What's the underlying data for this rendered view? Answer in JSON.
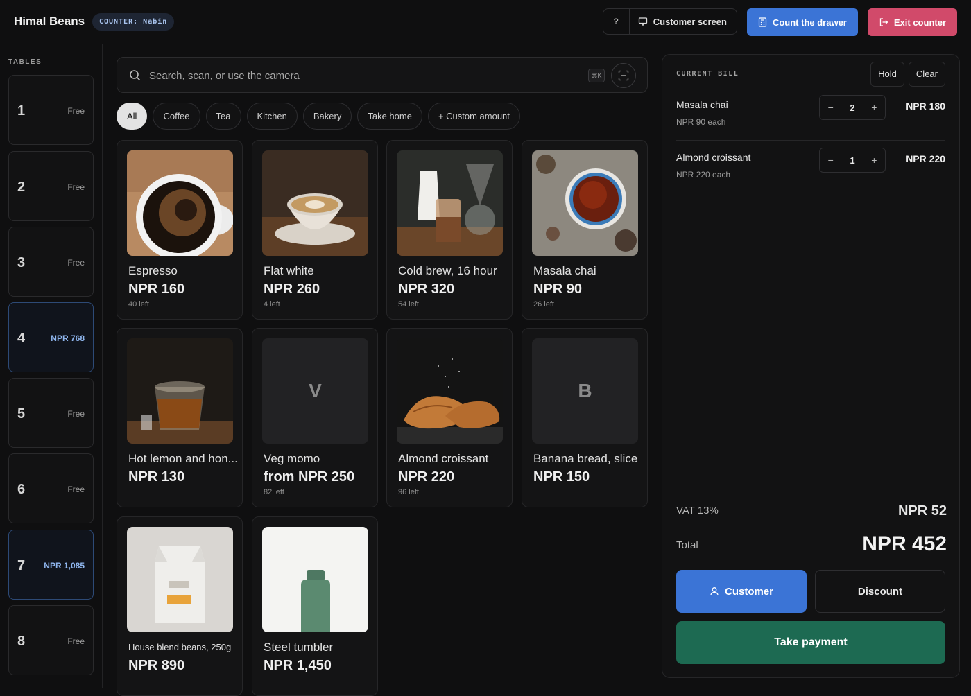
{
  "header": {
    "brand": "Himal Beans",
    "counter_label": "COUNTER: Nabin",
    "help_label": "?",
    "customer_screen_label": "Customer screen",
    "count_drawer_label": "Count the drawer",
    "exit_counter_label": "Exit counter"
  },
  "tables": {
    "title": "TABLES",
    "items": [
      {
        "number": "1",
        "status": "Free"
      },
      {
        "number": "2",
        "status": "Free"
      },
      {
        "number": "3",
        "status": "Free"
      },
      {
        "number": "4",
        "status": "NPR 768"
      },
      {
        "number": "5",
        "status": "Free"
      },
      {
        "number": "6",
        "status": "Free"
      },
      {
        "number": "7",
        "status": "NPR 1,085"
      },
      {
        "number": "8",
        "status": "Free"
      }
    ]
  },
  "search": {
    "placeholder": "Search, scan, or use the camera",
    "shortcut": "⌘K"
  },
  "categories": [
    "All",
    "Coffee",
    "Tea",
    "Kitchen",
    "Bakery",
    "Take home",
    "+ Custom amount"
  ],
  "products": [
    {
      "name": "Espresso",
      "price": "NPR 160",
      "stock": "40 left"
    },
    {
      "name": "Flat white",
      "price": "NPR 260",
      "stock": "4 left"
    },
    {
      "name": "Cold brew, 16 hour",
      "price": "NPR 320",
      "stock": "54 left"
    },
    {
      "name": "Masala chai",
      "price": "NPR 90",
      "stock": "26 left"
    },
    {
      "name": "Hot lemon and hon...",
      "price": "NPR 130",
      "stock": ""
    },
    {
      "name": "Veg momo",
      "price": "from NPR 250",
      "stock": "82 left",
      "letter": "V"
    },
    {
      "name": "Almond croissant",
      "price": "NPR 220",
      "stock": "96 left"
    },
    {
      "name": "Banana bread, slice",
      "price": "NPR 150",
      "stock": "",
      "letter": "B"
    },
    {
      "name": "House blend beans, 250g",
      "price": "NPR 890",
      "stock": ""
    },
    {
      "name": "Steel tumbler",
      "price": "NPR 1,450",
      "stock": ""
    }
  ],
  "bill": {
    "title": "CURRENT BILL",
    "hold_label": "Hold",
    "clear_label": "Clear",
    "items": [
      {
        "name": "Masala chai",
        "each": "NPR 90 each",
        "qty": "2",
        "total": "NPR 180"
      },
      {
        "name": "Almond croissant",
        "each": "NPR 220 each",
        "qty": "1",
        "total": "NPR 220"
      }
    ],
    "vat_label": "VAT 13%",
    "vat_value": "NPR 52",
    "total_label": "Total",
    "total_value": "NPR 452",
    "customer_label": "Customer",
    "discount_label": "Discount",
    "pay_label": "Take payment"
  }
}
